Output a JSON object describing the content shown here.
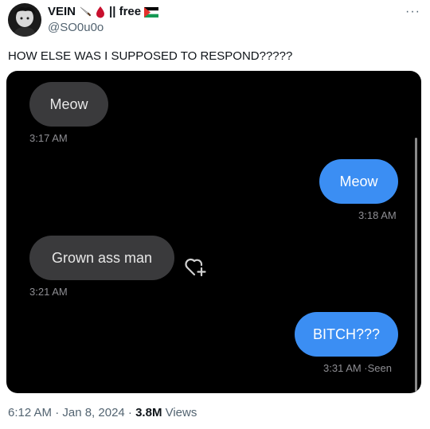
{
  "author": {
    "display_name": "VEIN",
    "name_suffix": "|| free",
    "handle": "@SO0u0o",
    "badges": [
      "knife-icon",
      "blood-drop-icon",
      "palestine-flag-icon"
    ]
  },
  "tweet": {
    "text": "HOW ELSE WAS I SUPPOSED TO RESPOND?????",
    "timestamp": "6:12 AM · Jan 8, 2024 · ",
    "views_count": "3.8M",
    "views_label": " Views"
  },
  "chat": {
    "messages": [
      {
        "side": "received",
        "text": "Meow",
        "time": "3:17 AM"
      },
      {
        "side": "sent",
        "text": "Meow",
        "time": "3:18 AM"
      },
      {
        "side": "received",
        "text": "Grown ass man",
        "time": "3:21 AM",
        "reaction_icon": "heart-add-icon"
      },
      {
        "side": "sent",
        "text": "BITCH???",
        "time": "3:31 AM",
        "status": "3:31 AM ·Seen"
      }
    ]
  },
  "colors": {
    "sent_bubble": "#3b8ef3",
    "received_bubble": "#3a3a3c",
    "chat_background": "#000000",
    "muted_text": "#536471"
  }
}
